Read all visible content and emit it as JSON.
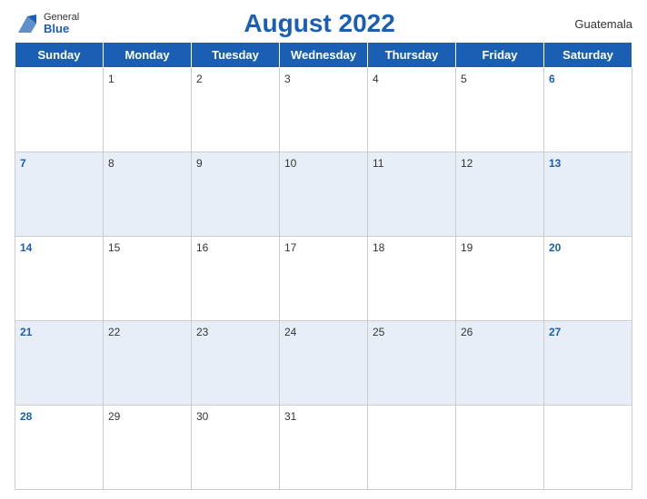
{
  "header": {
    "logo": {
      "general": "General",
      "blue": "Blue"
    },
    "title": "August 2022",
    "country": "Guatemala"
  },
  "weekdays": [
    "Sunday",
    "Monday",
    "Tuesday",
    "Wednesday",
    "Thursday",
    "Friday",
    "Saturday"
  ],
  "weeks": [
    [
      null,
      1,
      2,
      3,
      4,
      5,
      6
    ],
    [
      7,
      8,
      9,
      10,
      11,
      12,
      13
    ],
    [
      14,
      15,
      16,
      17,
      18,
      19,
      20
    ],
    [
      21,
      22,
      23,
      24,
      25,
      26,
      27
    ],
    [
      28,
      29,
      30,
      31,
      null,
      null,
      null
    ]
  ]
}
